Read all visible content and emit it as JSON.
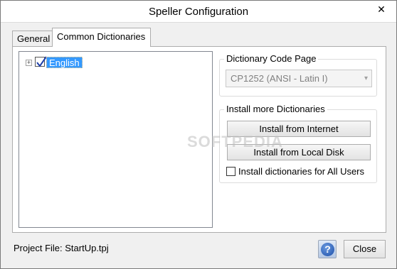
{
  "window": {
    "title": "Speller Configuration",
    "close_glyph": "✕"
  },
  "tabs": [
    {
      "label": "General",
      "selected": false
    },
    {
      "label": "Common Dictionaries",
      "selected": true
    }
  ],
  "tree": {
    "items": [
      {
        "label": "English",
        "checked": true,
        "expander": "+"
      }
    ]
  },
  "code_page": {
    "group_title": "Dictionary Code Page",
    "selected": "CP1252 (ANSI - Latin I)",
    "disabled": true
  },
  "install": {
    "group_title": "Install more Dictionaries",
    "internet_label": "Install from Internet",
    "local_disk_label": "Install from Local Disk",
    "all_users_label": "Install dictionaries for All Users",
    "all_users_checked": false
  },
  "watermark": "SOFTPEDIA",
  "footer": {
    "project_file": "Project File: StartUp.tpj",
    "help_glyph": "?",
    "close_label": "Close"
  },
  "colors": {
    "selection": "#3399ff",
    "accent_help": "#1c4ea8"
  }
}
